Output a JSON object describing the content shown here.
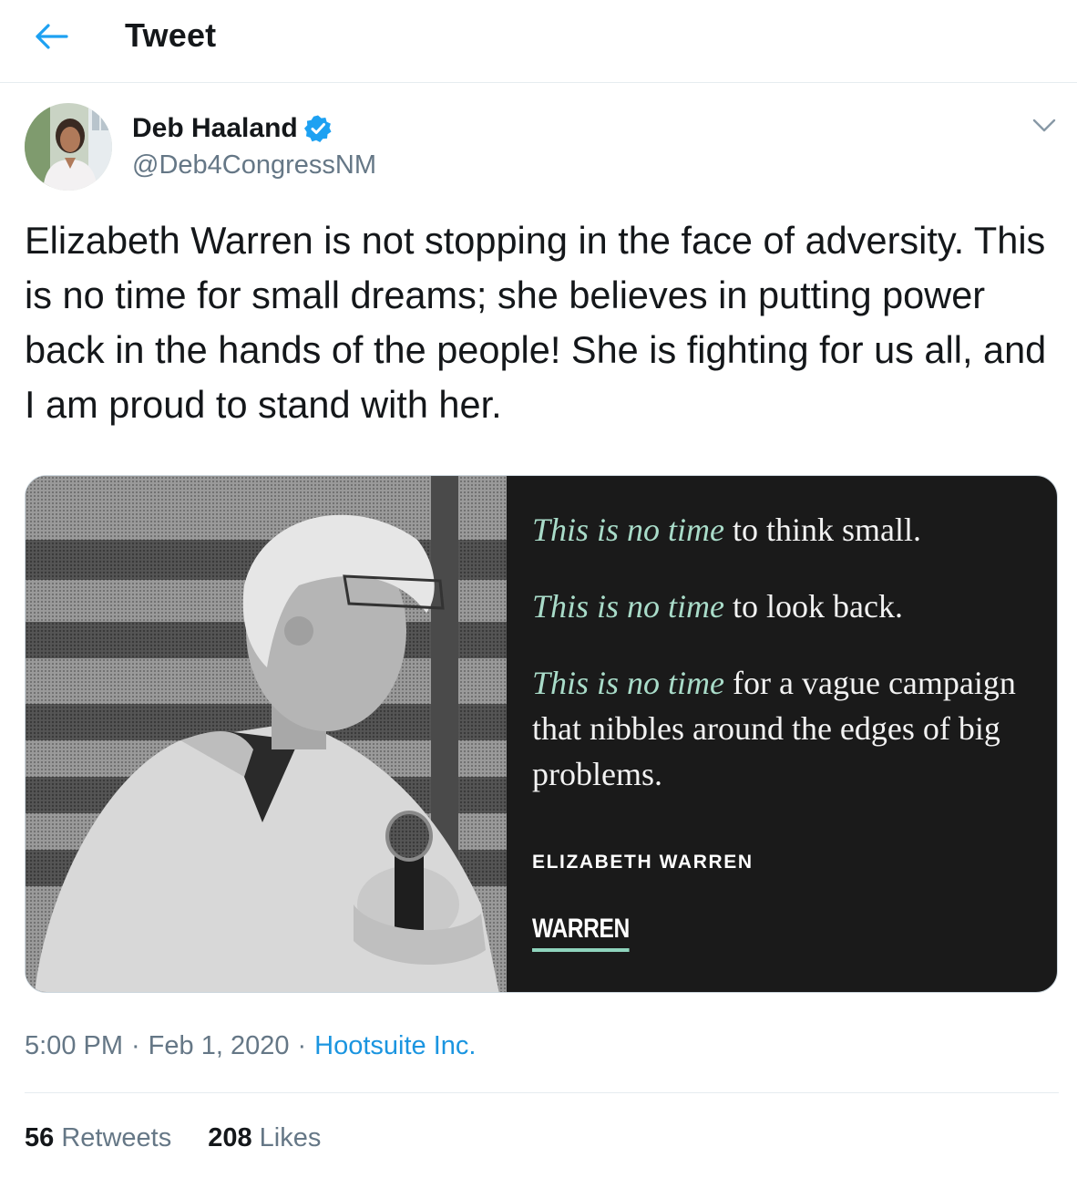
{
  "header": {
    "title": "Tweet",
    "back_icon": "arrow-left-icon"
  },
  "tweet": {
    "author": {
      "name": "Deb Haaland",
      "handle": "@Deb4CongressNM",
      "verified": true
    },
    "text": "Elizabeth Warren is not stopping in the face of adversity. This is no time for small dreams; she believes in putting power back in the hands of the people! She is fighting for us all, and I am proud to stand with her.",
    "media": {
      "quotes": [
        {
          "lead": "This is no time",
          "rest": " to think small."
        },
        {
          "lead": "This is no time",
          "rest": " to look back."
        },
        {
          "lead": "This is no time",
          "rest": " for a vague campaign that nibbles around the edges of big problems."
        }
      ],
      "attribution": "ELIZABETH WARREN",
      "logo": "WARREN"
    },
    "meta": {
      "time": "5:00 PM",
      "date": "Feb 1, 2020",
      "source": "Hootsuite Inc.",
      "separator": "·"
    },
    "stats": {
      "retweets": {
        "count": "56",
        "label": "Retweets"
      },
      "likes": {
        "count": "208",
        "label": "Likes"
      }
    }
  },
  "colors": {
    "accent": "#1b95e0",
    "verified": "#1da1f2",
    "quote_highlight": "#a9dcc9"
  }
}
